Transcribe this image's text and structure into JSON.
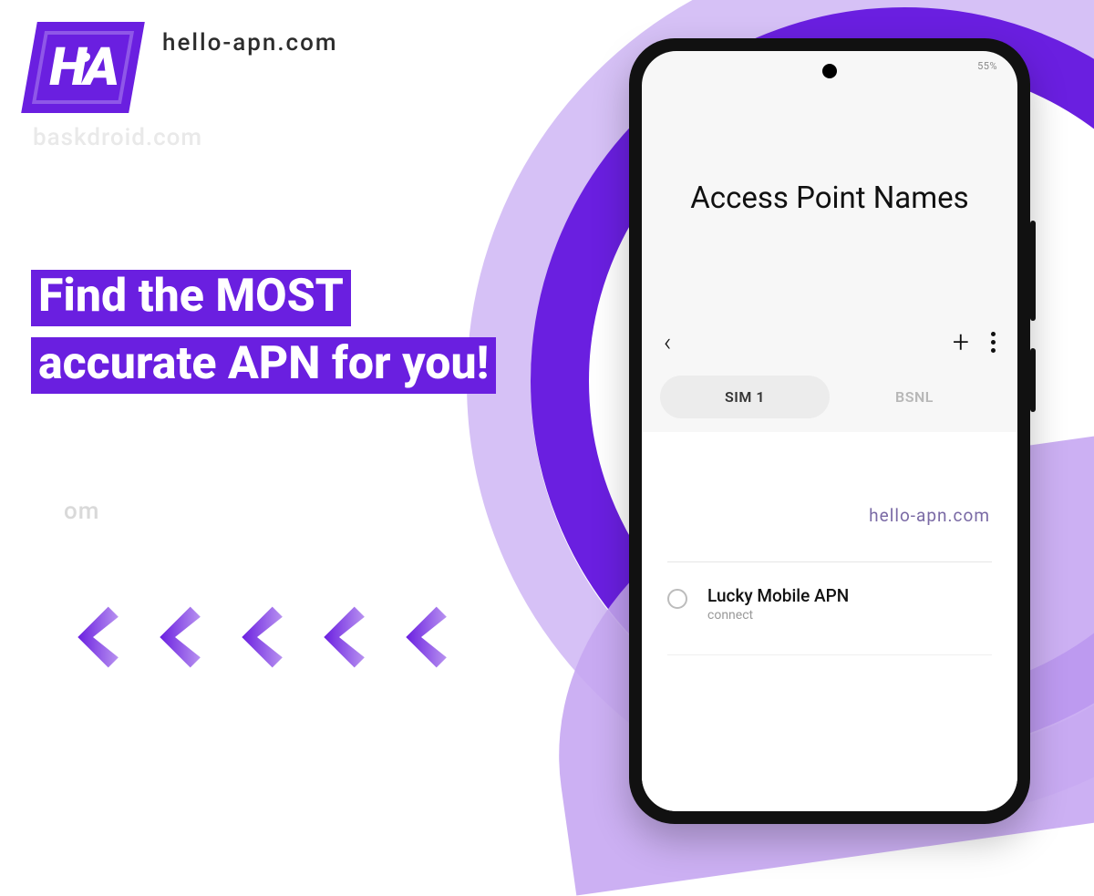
{
  "site": {
    "url_label": "hello-apn.com",
    "logo_text": "HA"
  },
  "watermarks": {
    "top": "baskdroid.com",
    "mid": "om"
  },
  "headline": {
    "text": "Find the MOST accurate APN for you!"
  },
  "phone": {
    "status_left": "",
    "status_right": "55%",
    "page_title": "Access Point Names",
    "tabs": {
      "sim1": "SIM 1",
      "sim2": "BSNL"
    },
    "watermark": "hello-apn.com",
    "apn": {
      "name": "Lucky Mobile APN",
      "sub": "connect"
    }
  }
}
